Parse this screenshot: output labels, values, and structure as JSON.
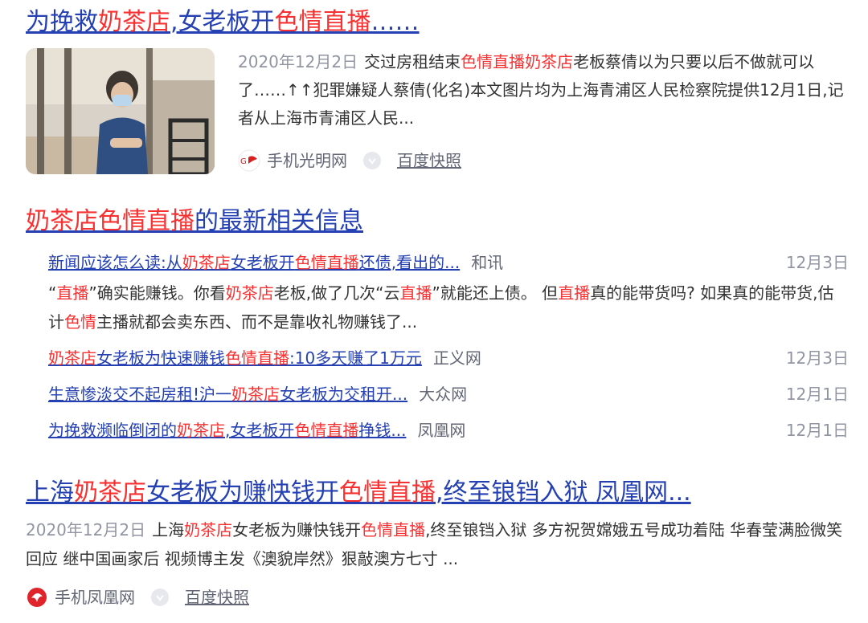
{
  "result1": {
    "title": {
      "p1": "为挽救",
      "h1": "奶茶店",
      "p2": ",女老板开",
      "h2": "色情直播",
      "p3": "……"
    },
    "date": "2020年12月2日",
    "abstract": {
      "p1": "交过房租结束",
      "h1": "色情直播奶茶店",
      "p2": "老板蔡倩以为只要以后不做就可以了……↑↑犯罪嫌疑人蔡倩(化名)本文图片均为上海青浦区人民检察院提供12月1日,记者从上海市青浦区人民..."
    },
    "source": "手机光明网",
    "snapshot": "百度快照"
  },
  "news_block": {
    "heading": {
      "h1": "奶茶店色情直播",
      "p1": "的最新相关信息"
    },
    "items": [
      {
        "p1": "新闻应该怎么读:从",
        "h1": "奶茶店",
        "p2": "女老板开",
        "h2": "色情直播",
        "p3": "还债,看出的...",
        "source": "和讯",
        "date": "12月3日"
      },
      {
        "p1": "",
        "h1": "奶茶店",
        "p2": "女老板为快速赚钱",
        "h2": "色情直播",
        "p3": ":10多天赚了1万元",
        "source": "正义网",
        "date": "12月3日"
      },
      {
        "p1": "生意惨淡交不起房租!沪一",
        "h1": "奶茶店",
        "p2": "女老板为交租开...",
        "h2": "",
        "p3": "",
        "source": "大众网",
        "date": "12月1日"
      },
      {
        "p1": "为挽救濒临倒闭的",
        "h1": "奶茶店",
        "p2": ",女老板开",
        "h2": "色情直播",
        "p3": "挣钱...",
        "source": "凤凰网",
        "date": "12月1日"
      }
    ],
    "abstract": {
      "q1": "“",
      "h1": "直播",
      "p1": "”确实能赚钱。你看",
      "h2": "奶茶店",
      "p2": "老板,做了几次“云",
      "h3": "直播",
      "p3": "”就能还上债。 但",
      "h4": "直播",
      "p4": "真的能带货吗? 如果真的能带货,估计",
      "h5": "色情",
      "p5": "主播就都会卖东西、而不是靠收礼物赚钱了..."
    }
  },
  "result3": {
    "title": {
      "p1": "上海",
      "h1": "奶茶店",
      "p2": "女老板为赚快钱开",
      "h2": "色情直播",
      "p3": ",终至锒铛入狱 凤凰网..."
    },
    "date": "2020年12月2日",
    "abstract": {
      "p1": "上海",
      "h1": "奶茶店",
      "p2": "女老板为赚快钱开",
      "h2": "色情直播",
      "p3": ",终至锒铛入狱 多方祝贺嫦娥五号成功着陆 华春莹满脸微笑回应 继中国画家后 视频博主发《澳貌岸然》狠敲澳方七寸 ..."
    },
    "source": "手机凤凰网",
    "snapshot": "百度快照"
  },
  "icons": {
    "thumbnail": "news-photo-thumbnail",
    "guangming_logo": "guangming-logo-icon",
    "ifeng_logo": "ifeng-logo-icon",
    "trust": "trust-shield-icon"
  },
  "colors": {
    "link": "#2440b3",
    "highlight": "#f73131",
    "meta": "#9195a3",
    "source": "#626675"
  }
}
